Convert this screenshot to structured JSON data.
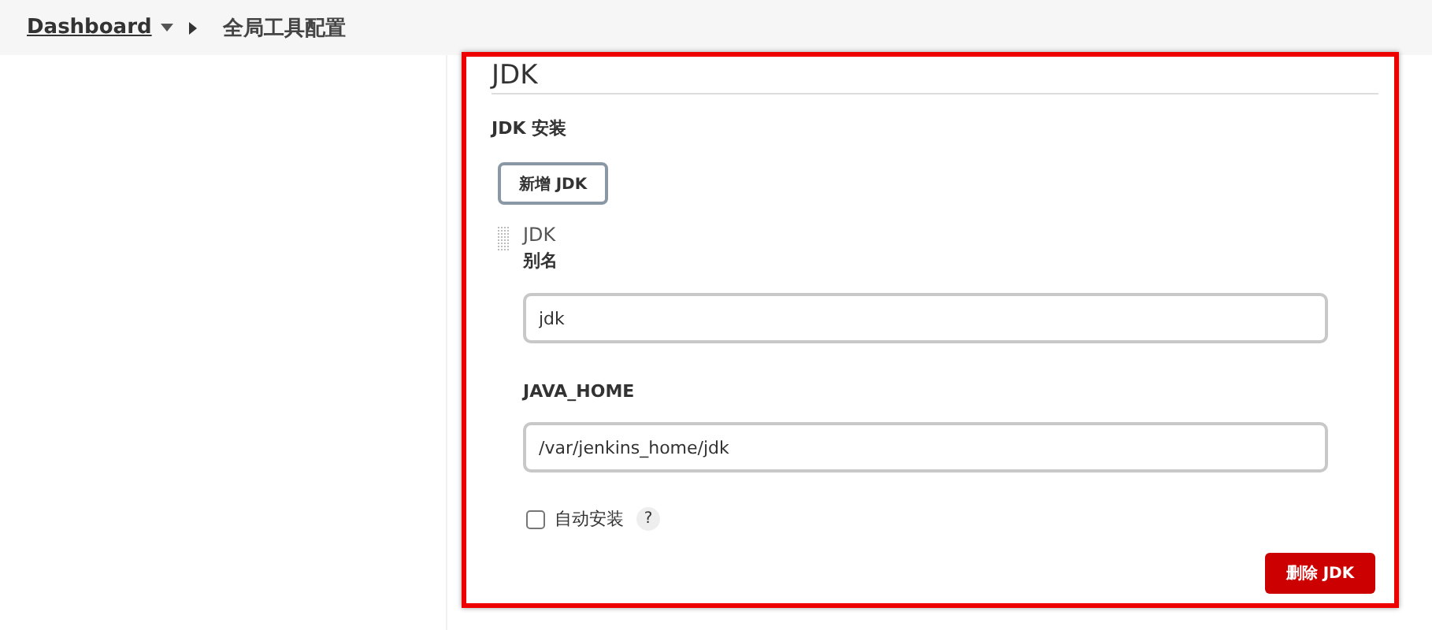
{
  "breadcrumb": {
    "items": [
      {
        "label": "Dashboard",
        "has_menu": true
      },
      {
        "label": "全局工具配置",
        "has_menu": false
      }
    ]
  },
  "section": {
    "title": "JDK",
    "subtitle": "JDK 安装",
    "add_button": "新增 JDK",
    "installation": {
      "heading": "JDK",
      "fields": [
        {
          "label": "别名",
          "value": "jdk"
        },
        {
          "label": "JAVA_HOME",
          "value": "/var/jenkins_home/jdk"
        }
      ],
      "auto_install": {
        "label": "自动安装",
        "checked": false,
        "help": "?"
      },
      "delete_button": "删除 JDK"
    }
  }
}
